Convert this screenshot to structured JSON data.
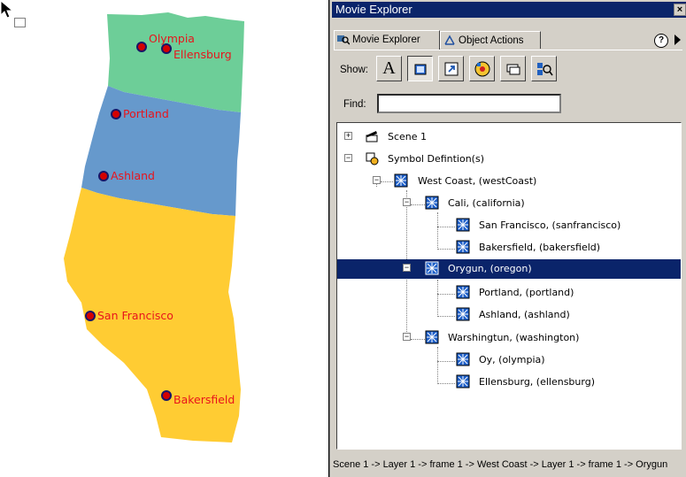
{
  "map": {
    "regions": [
      {
        "name": "washington",
        "color": "#6dce98"
      },
      {
        "name": "oregon",
        "color": "#6699cc"
      },
      {
        "name": "california",
        "color": "#ffcc33"
      }
    ],
    "city_dot_color": "#d40000",
    "city_label_color": "#e8141c",
    "cities": [
      {
        "label": "Olympia"
      },
      {
        "label": "Ellensburg"
      },
      {
        "label": "Portland"
      },
      {
        "label": "Ashland"
      },
      {
        "label": "San Francisco"
      },
      {
        "label": "Bakersfield"
      }
    ]
  },
  "panel": {
    "title": "Movie Explorer",
    "close_glyph": "×",
    "tabs": [
      {
        "label": "Movie Explorer",
        "icon": "movie-explorer-icon",
        "active": true
      },
      {
        "label": "Object Actions",
        "icon": "object-actions-icon",
        "active": false
      }
    ],
    "help_glyph": "?",
    "show_label": "Show:",
    "show_buttons": [
      {
        "icon": "text-icon",
        "glyph": "A",
        "pressed": false
      },
      {
        "icon": "buttons-movieclips-graphics-icon",
        "pressed": true
      },
      {
        "icon": "actionscripts-icon",
        "pressed": false
      },
      {
        "icon": "video-sound-bitmaps-icon",
        "pressed": false
      },
      {
        "icon": "frames-layers-icon",
        "pressed": false
      },
      {
        "icon": "customize-items-icon",
        "pressed": false
      }
    ],
    "find_label": "Find:",
    "find_value": "",
    "tree": [
      {
        "label": "Scene 1"
      },
      {
        "label": "Symbol Defintion(s)"
      },
      {
        "label": "West Coast, (westCoast)"
      },
      {
        "label": "Cali, (california)"
      },
      {
        "label": "San Francisco, (sanfrancisco)"
      },
      {
        "label": "Bakersfield, (bakersfield)"
      },
      {
        "label": "Orygun, (oregon)"
      },
      {
        "label": "Portland, (portland)"
      },
      {
        "label": "Ashland, (ashland)"
      },
      {
        "label": "Warshingtun, (washington)"
      },
      {
        "label": "Oy, (olympia)"
      },
      {
        "label": "Ellensburg, (ellensburg)"
      }
    ],
    "selected_label": "Orygun, (oregon)",
    "status_path": "Scene 1 -> Layer 1 -> frame 1 -> West Coast -> Layer 1 -> frame 1 -> Orygun"
  }
}
